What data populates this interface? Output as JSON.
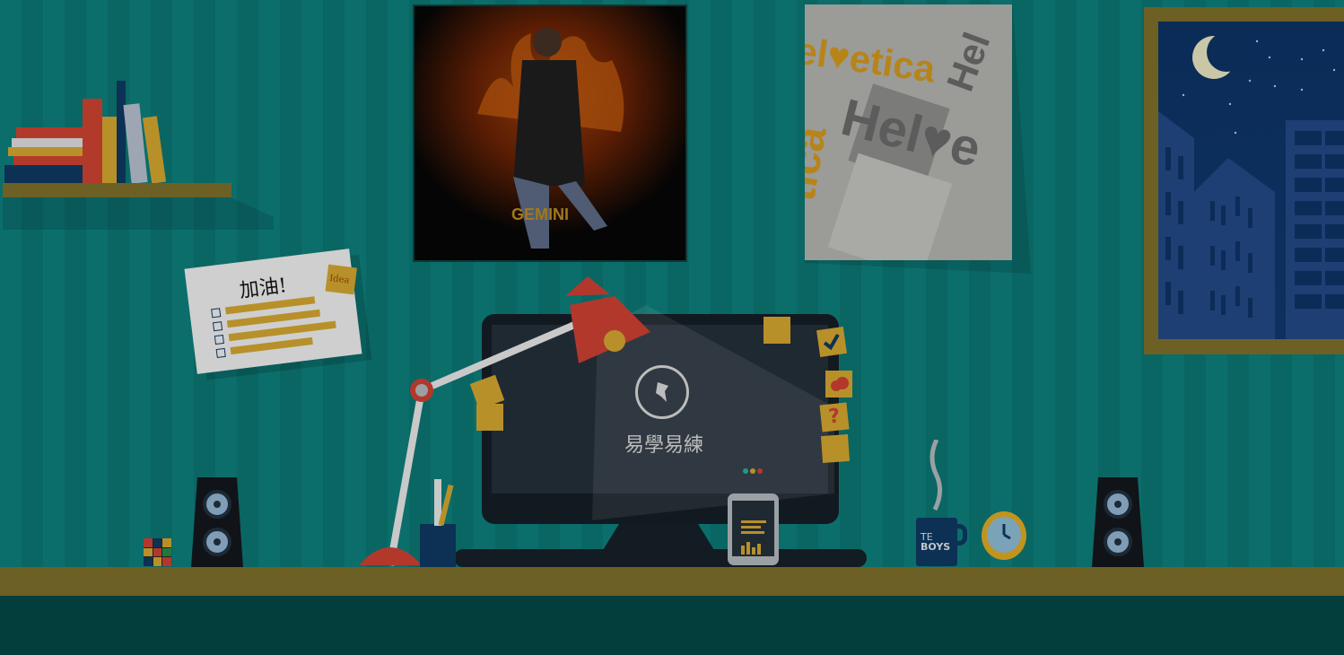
{
  "colors": {
    "wall": "#0b6e6b",
    "desk": "#6d6024",
    "desk_front": "#043e3c",
    "accent_yellow": "#c19420",
    "lamp_red": "#b2382c",
    "monitor": "#111a20"
  },
  "note": {
    "title": "加油!",
    "sticker": "Idea"
  },
  "poster_movie": {
    "title": "GEMINI"
  },
  "poster_type": {
    "words": [
      "el♥etica",
      "Hel",
      "Hel♥e",
      "tica"
    ]
  },
  "monitor": {
    "brand": "易學易練"
  },
  "mug": {
    "line1": "TE",
    "line2": "BOYS"
  },
  "icons": [
    "bird-logo-icon",
    "checkmark-icon",
    "cloud-icon",
    "question-mark-icon",
    "moon-icon",
    "clock-icon"
  ]
}
